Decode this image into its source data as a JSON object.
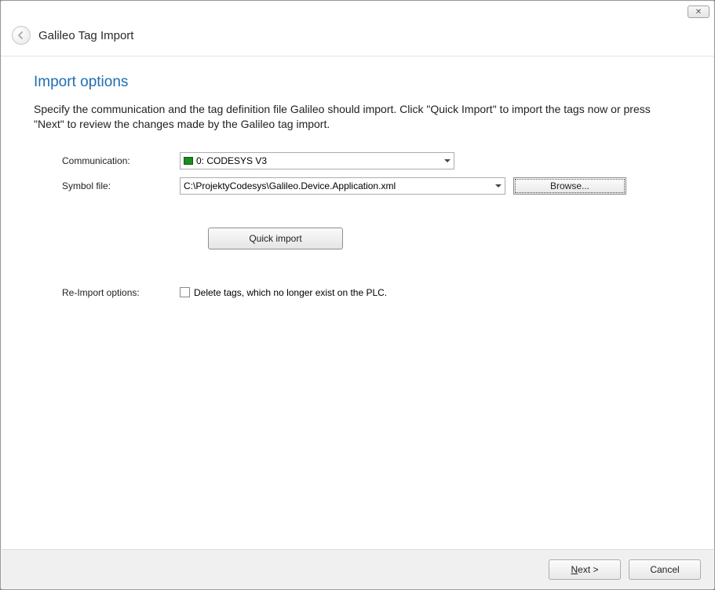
{
  "window": {
    "title": "Galileo Tag Import"
  },
  "page": {
    "heading": "Import options",
    "description": "Specify the communication and the tag definition file Galileo should import. Click \"Quick Import\" to import the tags now or press \"Next\" to review the changes made by the Galileo tag import."
  },
  "form": {
    "communication_label": "Communication:",
    "communication_value": "0: CODESYS V3",
    "symbolfile_label": "Symbol file:",
    "symbolfile_value": "C:\\ProjektyCodesys\\Galileo.Device.Application.xml",
    "browse_label": "Browse...",
    "quick_import_label": "Quick import",
    "reimport_label": "Re-Import options:",
    "delete_tags_label": "Delete tags, which no longer exist on the PLC.",
    "delete_tags_checked": false
  },
  "footer": {
    "next_mnemonic": "N",
    "next_rest": "ext >",
    "cancel_label": "Cancel"
  }
}
